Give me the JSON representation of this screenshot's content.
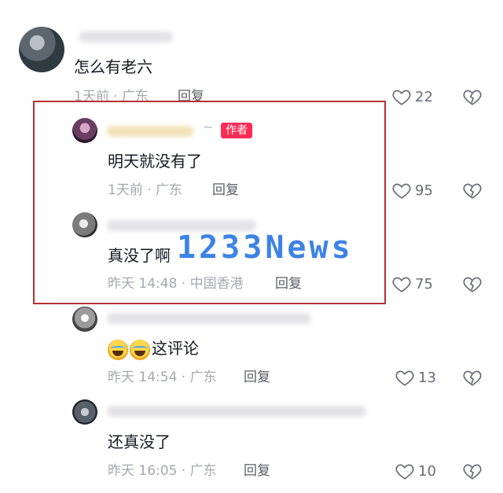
{
  "comments": [
    {
      "text": "怎么有老六",
      "time": "1天前 · 广东",
      "reply": "回复",
      "likes": "22"
    },
    {
      "text": "明天就没有了",
      "time": "1天前 · 广东",
      "reply": "回复",
      "likes": "95",
      "badge": "作者",
      "tilde": "~"
    },
    {
      "text": "真没了啊",
      "time": "昨天 14:48 · 中国香港",
      "reply": "回复",
      "likes": "75"
    },
    {
      "text": "这评论",
      "time": "昨天 14:54 · 广东",
      "reply": "回复",
      "likes": "13",
      "emojis": [
        "laugh-cry-emoji",
        "laugh-cry-emoji"
      ]
    },
    {
      "text": "还真没了",
      "time": "昨天 16:05 · 广东",
      "reply": "回复",
      "likes": "10"
    }
  ],
  "watermark": "1233News",
  "colors": {
    "badge": "#fe2c55",
    "highlight_border": "#b83236",
    "watermark": "#3d83e6"
  }
}
